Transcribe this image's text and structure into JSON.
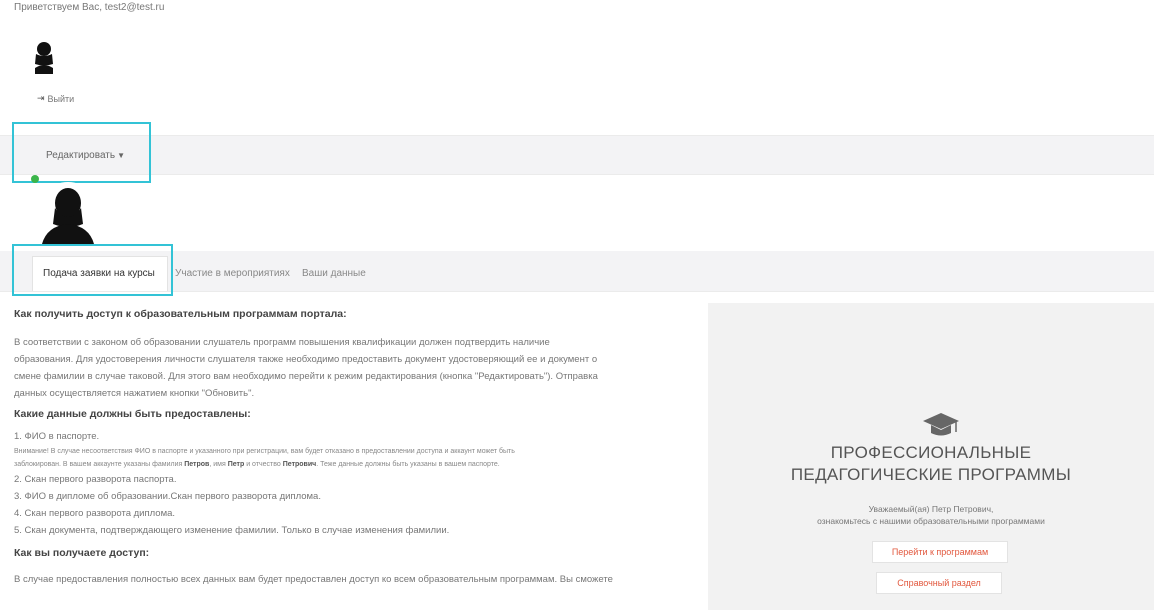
{
  "header": {
    "greeting": "Приветствуем Вас, test2@test.ru",
    "logout_label": "Выйти"
  },
  "toolbar": {
    "edit_label": "Редактировать"
  },
  "tabs": [
    {
      "label": "Подача заявки на курсы",
      "active": true
    },
    {
      "label": "Участие в мероприятиях",
      "active": false
    },
    {
      "label": "Ваши данные",
      "active": false
    }
  ],
  "content": {
    "h1": "Как получить доступ к образовательным программам портала:",
    "p1_l1": "В соответствии с законом об образовании слушатель программ повышения квалификации должен подтвердить наличие",
    "p1_l2": "образования. Для удостоверения личности слушателя также необходимо предоставить документ удостоверяющий ее и документ о",
    "p1_l3": "смене фамилии в случае таковой. Для этого вам необходимо перейти к режим редактирования (кнопка \"Редактировать\"). Отправка",
    "p1_l4": "данных осуществляется нажатием кнопки \"Обновить\".",
    "h2": "Какие данные должны быть предоставлены:",
    "item1": "1. ФИО в паспорте.",
    "warning_l1": "Внимание! В случае несоответствия ФИО в паспорте и указанного при регистрации, вам будет отказано в предоставлении доступа и аккаунт может быть",
    "warning_l2_a": "заблокирован. В вашем аккаунте указаны фамилия ",
    "surname": "Петров",
    "warning_l2_b": ", имя ",
    "name": "Петр",
    "warning_l2_c": " и отчество ",
    "patronymic": "Петрович",
    "warning_l2_d": ". Теже данные должны быть указаны в вашем паспорте.",
    "item2": "2. Скан первого разворота паспорта.",
    "item3": "3. ФИО в дипломе об образовании.Скан первого разворота диплома.",
    "item4": "4. Скан первого разворота диплома.",
    "item5": "5. Скан документа, подтверждающего изменение фамилии. Только в случае изменения фамилии.",
    "h3": "Как вы получаете доступ:",
    "p3_l1": "В случае предоставления полностью всех данных вам будет предоставлен доступ ко всем образовательным программам. Вы сможете"
  },
  "promo": {
    "icon": "graduation-cap-icon",
    "title_l1": "ПРОФЕССИОНАЛЬНЫЕ",
    "title_l2": "ПЕДАГОГИЧЕСКИЕ ПРОГРАММЫ",
    "salutation": "Уважаемый(ая) Петр Петрович,",
    "invite": "ознакомьтесь с нашими образовательными программами",
    "btn_programs": "Перейти к программам",
    "btn_reference": "Справочный раздел"
  },
  "colors": {
    "highlight": "#33c3d6",
    "status_online": "#3bb54a",
    "accent": "#e2583e"
  }
}
